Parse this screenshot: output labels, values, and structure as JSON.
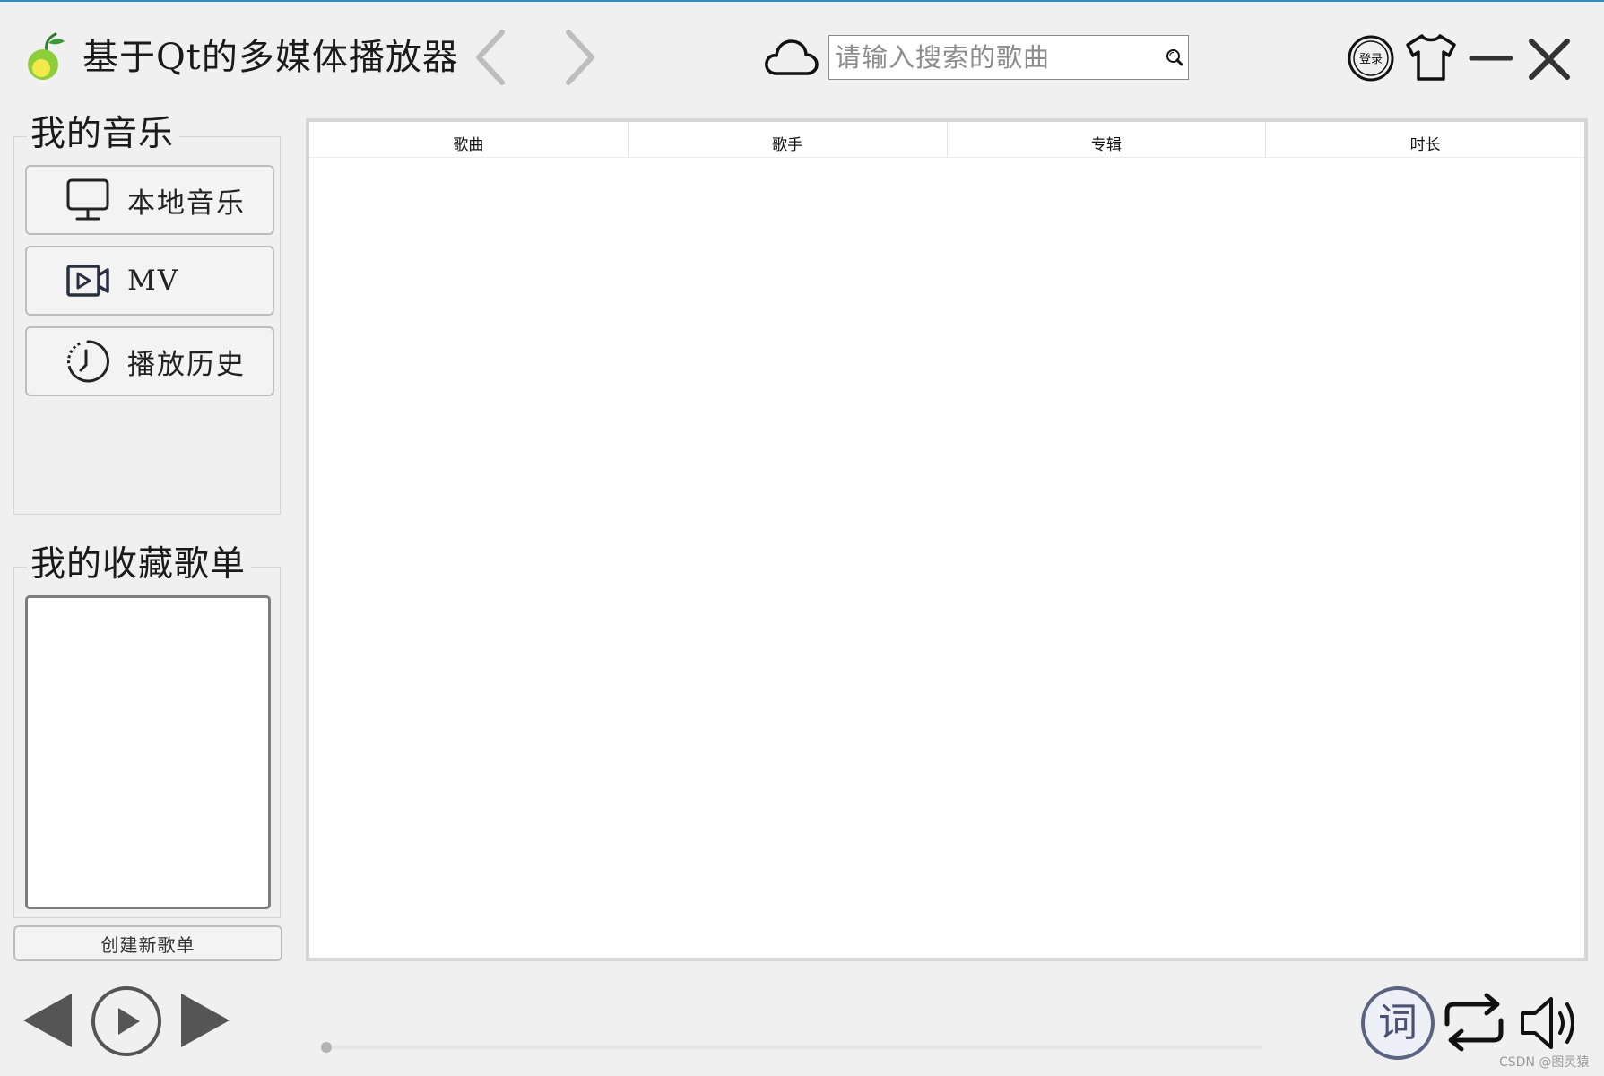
{
  "app": {
    "title": "基于Qt的多媒体播放器"
  },
  "header": {
    "search_placeholder": "请输入搜索的歌曲",
    "login_label": "登录"
  },
  "sidebar": {
    "music_group_title": "我的音乐",
    "items": [
      {
        "label": "本地音乐",
        "icon": "monitor-icon"
      },
      {
        "label": "MV",
        "icon": "video-icon"
      },
      {
        "label": "播放历史",
        "icon": "history-clock-icon"
      }
    ],
    "favorites_group_title": "我的收藏歌单",
    "create_playlist_label": "创建新歌单"
  },
  "table": {
    "columns": [
      "歌曲",
      "歌手",
      "专辑",
      "时长"
    ],
    "rows": []
  },
  "player": {
    "lyric_label": "词",
    "progress": 0
  },
  "watermark": "CSDN @图灵猿",
  "colors": {
    "accent_line": "#2f8fbd",
    "logo_green": "#8dcf3a",
    "logo_yellow": "#f3e94a",
    "lyric_ring": "#5b6380"
  }
}
